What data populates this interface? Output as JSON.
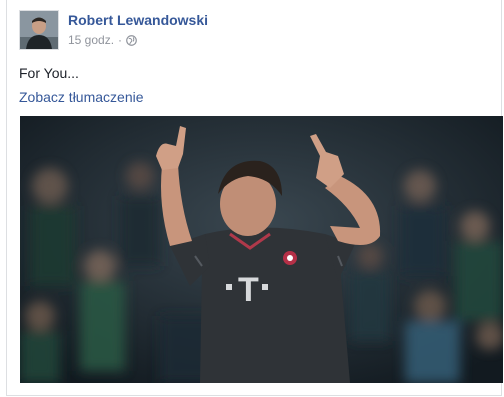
{
  "post": {
    "author_name": "Robert Lewandowski",
    "timestamp": "15 godz.",
    "separator": "·",
    "privacy_icon": "globe-icon",
    "text": "For You...",
    "translate_link": "Zobacz tłumaczenie",
    "avatar_icon": "profile-photo",
    "photo_icon": "post-photo"
  },
  "colors": {
    "link_blue": "#365899",
    "meta_gray": "#90949c",
    "text": "#1d2129",
    "border": "#dddfe2"
  }
}
